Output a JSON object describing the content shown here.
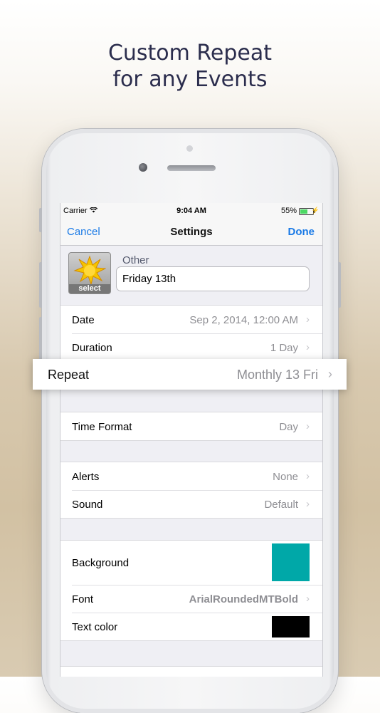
{
  "headline": {
    "line1": "Custom Repeat",
    "line2": "for any Events"
  },
  "status_bar": {
    "carrier": "Carrier",
    "time": "9:04 AM",
    "battery": "55%",
    "battery_level": 0.55
  },
  "nav": {
    "cancel": "Cancel",
    "title": "Settings",
    "done": "Done"
  },
  "event": {
    "type": "Other",
    "name": "Friday 13th",
    "icon_label": "select"
  },
  "rows": {
    "date": {
      "label": "Date",
      "value": "Sep 2, 2014, 12:00 AM"
    },
    "duration": {
      "label": "Duration",
      "value": "1 Day"
    },
    "repeat": {
      "label": "Repeat",
      "value": "Monthly 13 Fri"
    },
    "time_format": {
      "label": "Time Format",
      "value": "Day"
    },
    "alerts": {
      "label": "Alerts",
      "value": "None"
    },
    "sound": {
      "label": "Sound",
      "value": "Default"
    },
    "background": {
      "label": "Background",
      "color": "#00a8a8"
    },
    "font": {
      "label": "Font",
      "value": "ArialRoundedMTBold"
    },
    "text_color": {
      "label": "Text color",
      "color": "#000000"
    }
  },
  "chevron": "›",
  "colors": {
    "accent": "#1a7ae6",
    "background_swatch": "#00a8a8",
    "text_swatch": "#000000"
  }
}
